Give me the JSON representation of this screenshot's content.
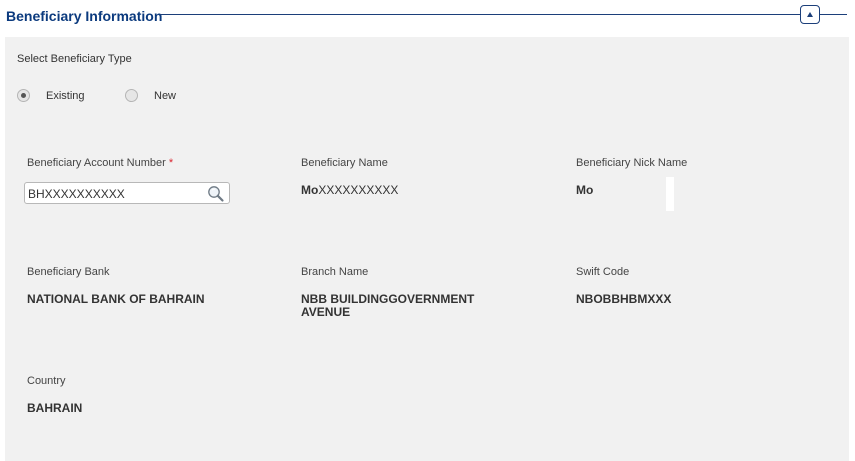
{
  "section": {
    "title": "Beneficiary Information",
    "collapse_icon": "triangle-up-icon"
  },
  "beneficiary_type": {
    "label": "Select Beneficiary Type",
    "options": [
      {
        "label": "Existing",
        "checked": true
      },
      {
        "label": "New",
        "checked": false
      }
    ]
  },
  "fields": {
    "account_number": {
      "label": "Beneficiary Account Number",
      "required_mark": "*",
      "value": "BHXXXXXXXXXX",
      "icon": "search-icon"
    },
    "beneficiary_name": {
      "label": "Beneficiary Name",
      "value_prefix": "Mo",
      "value_masked": "XXXXXXXXXX"
    },
    "nick_name": {
      "label": "Beneficiary Nick Name",
      "value": "Mo"
    },
    "bank": {
      "label": "Beneficiary Bank",
      "value": "NATIONAL BANK OF BAHRAIN"
    },
    "branch": {
      "label": "Branch Name",
      "value_line1": "NBB BUILDINGGOVERNMENT",
      "value_line2": "AVENUE"
    },
    "swift": {
      "label": "Swift Code",
      "value": "NBOBBHBMXXX"
    },
    "country": {
      "label": "Country",
      "value": "BAHRAIN"
    }
  },
  "colors": {
    "title": "#0b3a7e",
    "panel_bg": "#f1f1f1",
    "required": "#d9232e"
  }
}
